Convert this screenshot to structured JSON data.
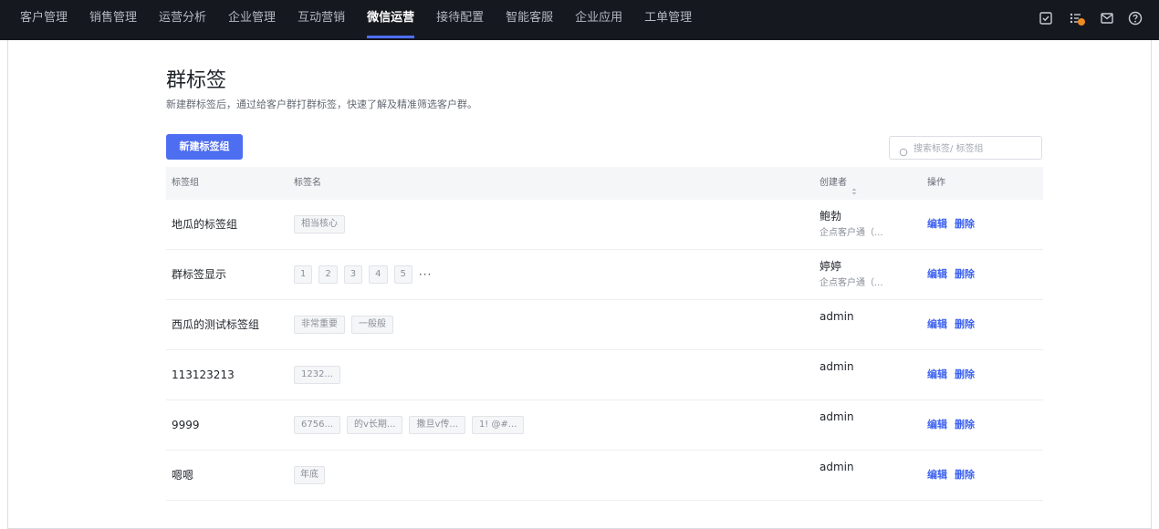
{
  "nav": [
    {
      "label": "客户管理",
      "active": false
    },
    {
      "label": "销售管理",
      "active": false
    },
    {
      "label": "运营分析",
      "active": false
    },
    {
      "label": "企业管理",
      "active": false
    },
    {
      "label": "互动营销",
      "active": false
    },
    {
      "label": "微信运营",
      "active": true
    },
    {
      "label": "接待配置",
      "active": false
    },
    {
      "label": "智能客服",
      "active": false
    },
    {
      "label": "企业应用",
      "active": false
    },
    {
      "label": "工单管理",
      "active": false
    }
  ],
  "page": {
    "title": "群标签",
    "subtitle": "新建群标签后，通过给客户群打群标签，快速了解及精准筛选客户群。",
    "new_button": "新建标签组",
    "search_placeholder": "搜索标签/ 标签组"
  },
  "table": {
    "headers": {
      "group": "标签组",
      "tags": "标签名",
      "creator": "创建者",
      "ops": "操作"
    },
    "edit_label": "编辑",
    "delete_label": "删除",
    "more_label": "···",
    "rows": [
      {
        "group": "地瓜的标签组",
        "tags": [
          "相当核心"
        ],
        "creator": "鲍勃",
        "org": "企点客户通（..."
      },
      {
        "group": "群标签显示",
        "tags": [
          "1",
          "2",
          "3",
          "4",
          "5"
        ],
        "more": true,
        "creator": "婷婷",
        "org": "企点客户通（..."
      },
      {
        "group": "西瓜的测试标签组",
        "tags": [
          "非常重要",
          "一般般"
        ],
        "creator": "admin",
        "org": ""
      },
      {
        "group": "113123213",
        "tags": [
          "1232..."
        ],
        "creator": "admin",
        "org": ""
      },
      {
        "group": "9999",
        "tags": [
          "6756...",
          "的v长期...",
          "撒旦v传...",
          "1! @#..."
        ],
        "creator": "admin",
        "org": ""
      },
      {
        "group": "嗯嗯",
        "tags": [
          "年底"
        ],
        "creator": "admin",
        "org": ""
      }
    ]
  },
  "colors": {
    "accent": "#4e6ef2",
    "link": "#3f63f0",
    "topbar": "#16181f"
  }
}
